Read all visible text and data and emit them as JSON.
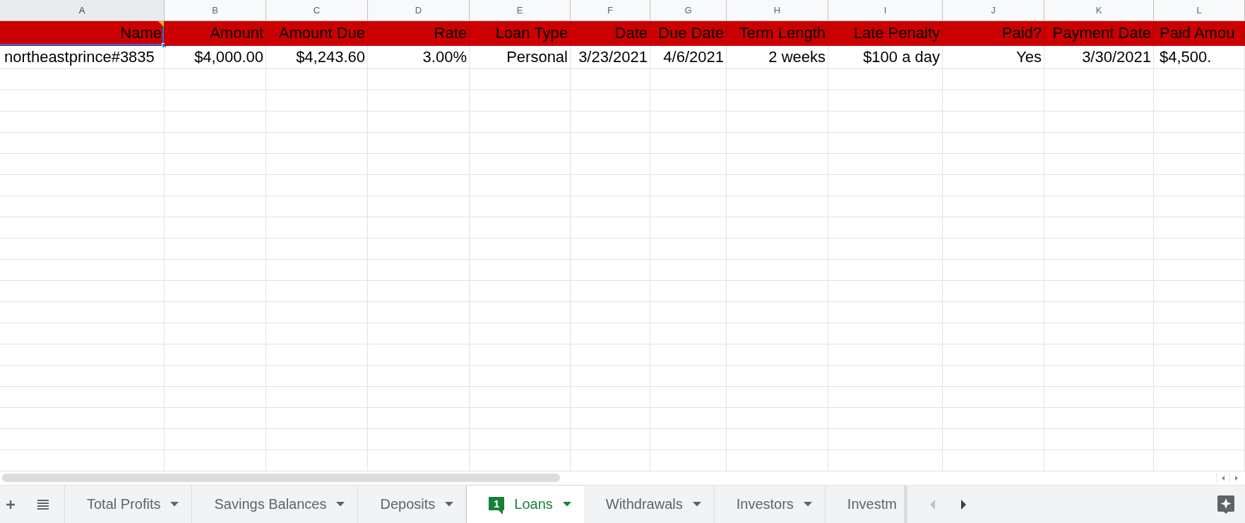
{
  "columns": [
    {
      "label": "A",
      "selected": true
    },
    {
      "label": "B",
      "selected": false
    },
    {
      "label": "C",
      "selected": false
    },
    {
      "label": "D",
      "selected": false
    },
    {
      "label": "E",
      "selected": false
    },
    {
      "label": "F",
      "selected": false
    },
    {
      "label": "G",
      "selected": false
    },
    {
      "label": "H",
      "selected": false
    },
    {
      "label": "I",
      "selected": false
    },
    {
      "label": "J",
      "selected": false
    },
    {
      "label": "K",
      "selected": false
    },
    {
      "label": "L",
      "selected": false
    }
  ],
  "rows": [
    {
      "kind": "header",
      "selected": true,
      "cells": [
        "Name",
        "Amount",
        "Amount Due",
        "Rate",
        "Loan Type",
        "Date",
        "Due Date",
        "Term Length",
        "Late Penalty",
        "Paid?",
        "Payment Date",
        "Paid Amou"
      ]
    },
    {
      "kind": "data",
      "selected": false,
      "cells": [
        "northeastprince#3835",
        "$4,000.00",
        "$4,243.60",
        "3.00%",
        "Personal",
        "3/23/2021",
        "4/6/2021",
        "2 weeks",
        "$100 a day",
        "Yes",
        "3/30/2021",
        "$4,500."
      ]
    }
  ],
  "active_cell_note": true,
  "tabs": [
    {
      "label": "Total Profits",
      "selected": false,
      "dropdown": true
    },
    {
      "label": "Savings Balances",
      "selected": false,
      "dropdown": true
    },
    {
      "label": "Deposits",
      "selected": false,
      "dropdown": true
    },
    {
      "label": "Loans",
      "selected": true,
      "dropdown": true,
      "badge": "1"
    },
    {
      "label": "Withdrawals",
      "selected": false,
      "dropdown": true
    },
    {
      "label": "Investors",
      "selected": false,
      "dropdown": true
    },
    {
      "label": "Investm",
      "selected": false,
      "dropdown": false
    }
  ]
}
